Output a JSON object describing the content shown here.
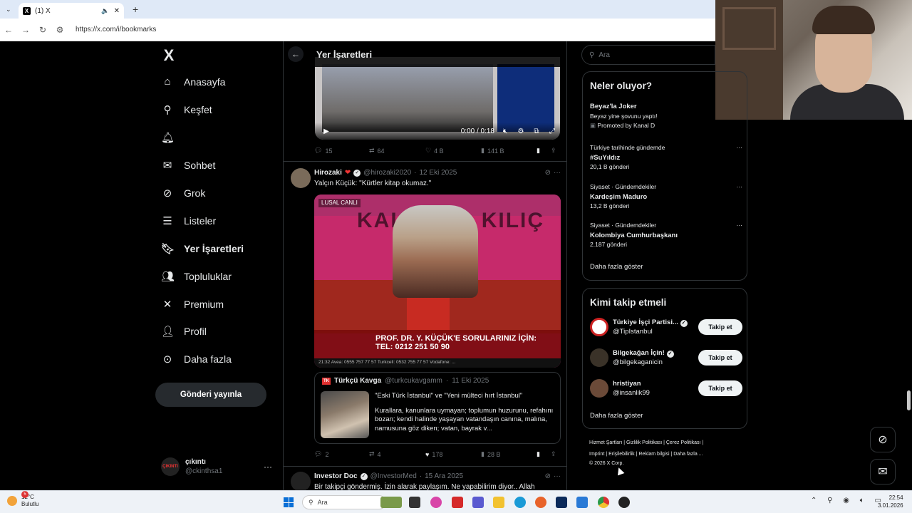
{
  "browser": {
    "tab_title": "(1) X",
    "url": "https://x.com/i/bookmarks"
  },
  "sidebar": {
    "logo": "X",
    "items": [
      {
        "label": "Anasayfa",
        "icon": "home-icon"
      },
      {
        "label": "Keşfet",
        "icon": "search-icon"
      },
      {
        "label": "",
        "icon": "bell-icon"
      },
      {
        "label": "Sohbet",
        "icon": "mail-icon"
      },
      {
        "label": "Grok",
        "icon": "grok-icon"
      },
      {
        "label": "Listeler",
        "icon": "list-icon"
      },
      {
        "label": "Yer İşaretleri",
        "icon": "bookmark-icon"
      },
      {
        "label": "Topluluklar",
        "icon": "communities-icon"
      },
      {
        "label": "Premium",
        "icon": "x-icon"
      },
      {
        "label": "Profil",
        "icon": "person-icon"
      },
      {
        "label": "Daha fazla",
        "icon": "more-circle-icon"
      }
    ],
    "post_button": "Gönderi yayınla",
    "account": {
      "name": "çıkıntı",
      "handle": "@ckinthsa1",
      "avatar_text": "ÇIKINTI"
    }
  },
  "main": {
    "title": "Yer İşaretleri",
    "tweet1": {
      "video_time": "0:00 / 0:18",
      "replies": "15",
      "retweets": "64",
      "likes": "4 B",
      "views": "141 B"
    },
    "tweet2": {
      "name": "Hirozaki",
      "handle": "@hirozaki2020",
      "date": "12 Eki 2025",
      "text": "Yalçın Küçük: \"Kürtler kitap okumaz.\"",
      "video_tag": "LUSAL\nCANLI",
      "video_word": "KALEM ve KILIÇ",
      "video_banner": "PROF. DR. Y. KÜÇÜK'E SORULARINIZ İÇİN:",
      "video_banner2": "TEL: 0212 251 50 90",
      "video_strip": "21:32    Avea: 0555 757 77 57  Turkcell: 0532 755 77 57  Vodafone: ...",
      "quote": {
        "logo": "TK",
        "name": "Türkçü Kavga",
        "handle": "@turkcukavgamm",
        "date": "11 Eki 2025",
        "line1": "\"Eski Türk İstanbul\" ve \"Yeni mülteci hırt İstanbul\"",
        "line2": "Kurallara, kanunlara uymayan; toplumun huzurunu, refahını bozan; kendi halinde yaşayan vatandaşın canına, malına, namusuna göz diken; vatan, bayrak v..."
      },
      "replies": "2",
      "retweets": "4",
      "likes": "178",
      "views": "28 B"
    },
    "tweet3": {
      "name": "Investor Doc",
      "handle": "@InvestorMed",
      "date": "15 Ara 2025",
      "text": "Bir takipçi göndermiş. İzin alarak paylaşım. Ne yapabilirim diyor.. Allah"
    }
  },
  "right": {
    "search_placeholder": "Ara",
    "trends_title": "Neler oluyor?",
    "trends": [
      {
        "meta": "",
        "title": "Beyaz'la Joker",
        "sub": "Beyaz yine şovunu yaptı!",
        "extra": "Promoted by Kanal D"
      },
      {
        "meta": "Türkiye tarihinde gündemde",
        "title": "#SuYıldız",
        "sub": "20,1 B gönderi"
      },
      {
        "meta": "Siyaset · Gündemdekiler",
        "title": "Kardeşim Maduro",
        "sub": "13,2 B gönderi"
      },
      {
        "meta": "Siyaset · Gündemdekiler",
        "title": "Kolombiya Cumhurbaşkanı",
        "sub": "2.187 gönderi"
      }
    ],
    "trends_more": "Daha fazla göster",
    "follow_title": "Kimi takip etmeli",
    "follow": [
      {
        "name": "Türkiye İşçi Partisi...",
        "handle": "@TipIstanbul",
        "button": "Takip et"
      },
      {
        "name": "Bilgekağan İçin!",
        "handle": "@bilgekaganicin",
        "button": "Takip et"
      },
      {
        "name": "hristiyan",
        "handle": "@insanlik99",
        "button": "Takip et"
      }
    ],
    "follow_more": "Daha fazla göster",
    "footer": {
      "l1": "Hizmet Şartları  |  Gizlilik Politikası  |  Çerez Politikası  |",
      "l2": "Imprint  |  Erişilebilirlik  |  Reklam bilgisi  |  Daha fazla ...",
      "l3": "© 2026 X Corp."
    }
  },
  "taskbar": {
    "weather_temp": "12°C",
    "weather_desc": "Bulutlu",
    "weather_badge": "5",
    "search_placeholder": "Ara",
    "time": "22:54",
    "date": "3.01.2026"
  }
}
